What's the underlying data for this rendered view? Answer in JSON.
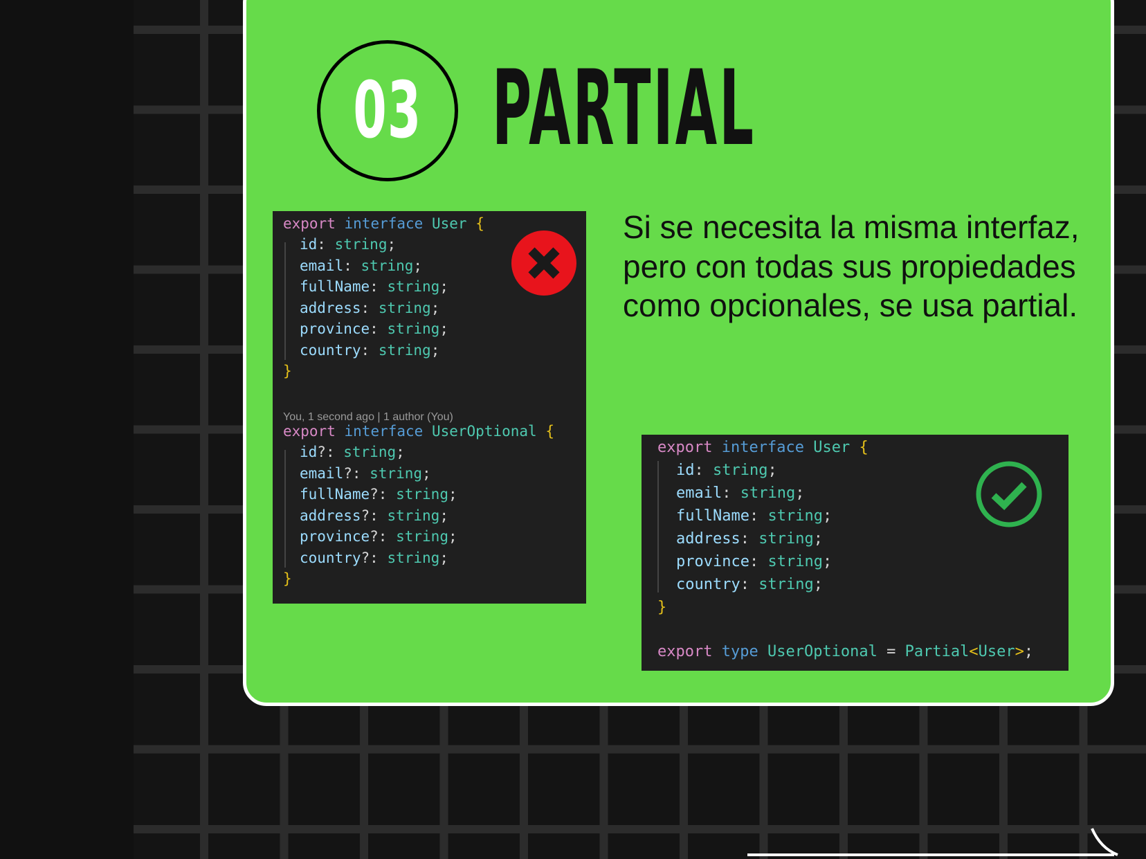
{
  "badge": {
    "number": "03"
  },
  "title": "PARTIAL",
  "description": "Si se necesita la misma interfaz, pero con todas sus propiedades como opcionales, se usa partial.",
  "colors": {
    "card_green": "#66db4a",
    "code_bg": "#1f1f1f",
    "keyword_pink": "#d889c6",
    "keyword_blue": "#569cd6",
    "type_teal": "#4ec9b0",
    "brace_yellow": "#e5c01a",
    "error_red": "#e8141c",
    "success_green": "#2fb24f"
  },
  "bad_example": {
    "status_icon": "x-circle-icon",
    "interface1": {
      "export": "export",
      "interface": "interface",
      "name": "User",
      "open": "{",
      "close": "}",
      "props": [
        {
          "name": "id",
          "colon": ":",
          "type": "string",
          "semi": ";"
        },
        {
          "name": "email",
          "colon": ":",
          "type": "string",
          "semi": ";"
        },
        {
          "name": "fullName",
          "colon": ":",
          "type": "string",
          "semi": ";"
        },
        {
          "name": "address",
          "colon": ":",
          "type": "string",
          "semi": ";"
        },
        {
          "name": "province",
          "colon": ":",
          "type": "string",
          "semi": ";"
        },
        {
          "name": "country",
          "colon": ":",
          "type": "string",
          "semi": ";"
        }
      ]
    },
    "blame": "You, 1 second ago | 1 author (You)",
    "interface2": {
      "export": "export",
      "interface": "interface",
      "name": "UserOptional",
      "open": "{",
      "close": "}",
      "props": [
        {
          "name": "id",
          "colon": "?:",
          "type": "string",
          "semi": ";"
        },
        {
          "name": "email",
          "colon": "?:",
          "type": "string",
          "semi": ";"
        },
        {
          "name": "fullName",
          "colon": "?:",
          "type": "string",
          "semi": ";"
        },
        {
          "name": "address",
          "colon": "?:",
          "type": "string",
          "semi": ";"
        },
        {
          "name": "province",
          "colon": "?:",
          "type": "string",
          "semi": ";"
        },
        {
          "name": "country",
          "colon": "?:",
          "type": "string",
          "semi": ";"
        }
      ]
    }
  },
  "good_example": {
    "status_icon": "check-circle-icon",
    "interface1": {
      "export": "export",
      "interface": "interface",
      "name": "User",
      "open": "{",
      "close": "}",
      "props": [
        {
          "name": "id",
          "colon": ":",
          "type": "string",
          "semi": ";"
        },
        {
          "name": "email",
          "colon": ":",
          "type": "string",
          "semi": ";"
        },
        {
          "name": "fullName",
          "colon": ":",
          "type": "string",
          "semi": ";"
        },
        {
          "name": "address",
          "colon": ":",
          "type": "string",
          "semi": ";"
        },
        {
          "name": "province",
          "colon": ":",
          "type": "string",
          "semi": ";"
        },
        {
          "name": "country",
          "colon": ":",
          "type": "string",
          "semi": ";"
        }
      ]
    },
    "type_line": {
      "export": "export",
      "type": "type",
      "name": "UserOptional",
      "eq": "=",
      "generic": "Partial",
      "lt": "<",
      "arg": "User",
      "gt": ">",
      "semi": ";"
    }
  },
  "next_arrow_icon": "arrow-right-icon"
}
